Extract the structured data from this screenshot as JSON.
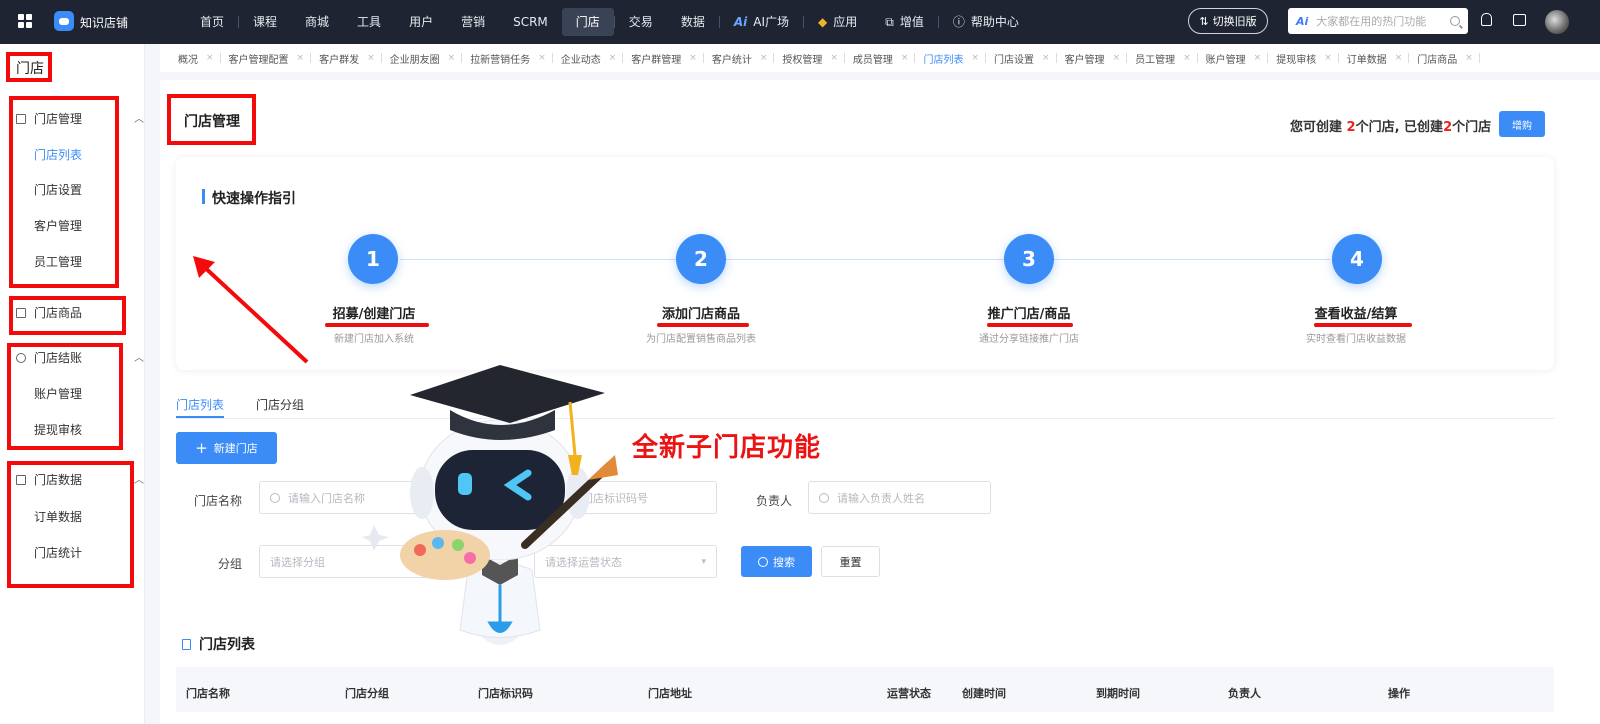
{
  "topbar": {
    "brand": "知识店铺",
    "nav": [
      "首页",
      "课程",
      "商城",
      "工具",
      "用户",
      "营销",
      "SCRM",
      "门店",
      "交易",
      "数据",
      "AI广场",
      "应用",
      "增值",
      "帮助中心"
    ],
    "nav_ai_prefix": "Ai",
    "switch_label": "切换旧版",
    "search_ai_badge": "Ai",
    "search_placeholder": "大家都在用的热门功能"
  },
  "sidebar": {
    "title": "门店",
    "groups": [
      {
        "label": "门店管理",
        "icon": "building-icon",
        "items": [
          "门店列表",
          "门店设置",
          "客户管理",
          "员工管理"
        ]
      },
      {
        "label": "门店商品",
        "icon": "goods-icon",
        "items": []
      },
      {
        "label": "门店结账",
        "icon": "database-icon",
        "items": [
          "账户管理",
          "提现审核"
        ]
      },
      {
        "label": "门店数据",
        "icon": "chart-icon",
        "items": [
          "订单数据",
          "门店统计"
        ]
      }
    ]
  },
  "tabs": [
    "概况",
    "客户管理配置",
    "客户群发",
    "企业朋友圈",
    "拉新营销任务",
    "企业动态",
    "客户群管理",
    "客户统计",
    "授权管理",
    "成员管理",
    "门店列表",
    "门店设置",
    "客户管理",
    "员工管理",
    "账户管理",
    "提现审核",
    "订单数据",
    "门店商品"
  ],
  "page": {
    "title": "门店管理",
    "quota_prefix": "您可创建",
    "quota_total": "2",
    "quota_mid": "个门店, 已创建",
    "quota_used": "2",
    "quota_suffix": "个门店",
    "buy_label": "增购"
  },
  "guide": {
    "title": "快速操作指引",
    "steps": [
      {
        "num": "1",
        "title": "招募/创建门店",
        "desc": "新建门店加入系统"
      },
      {
        "num": "2",
        "title": "添加门店商品",
        "desc": "为门店配置销售商品列表"
      },
      {
        "num": "3",
        "title": "推广门店/商品",
        "desc": "通过分享链接推广门店"
      },
      {
        "num": "4",
        "title": "查看收益/结算",
        "desc": "实时查看门店收益数据"
      }
    ]
  },
  "list_tabs": [
    "门店列表",
    "门店分组"
  ],
  "new_store_label": "新建门店",
  "filters": {
    "name_label": "门店名称",
    "name_placeholder": "请输入门店名称",
    "code_placeholder": "请输入门店标识码号",
    "owner_label": "负责人",
    "owner_placeholder": "请输入负责人姓名",
    "group_label": "分组",
    "group_placeholder": "请选择分组",
    "status_placeholder": "请选择运营状态",
    "search_label": "搜索",
    "reset_label": "重置"
  },
  "list": {
    "title": "门店列表",
    "columns": [
      "门店名称",
      "门店分组",
      "门店标识码",
      "门店地址",
      "运营状态",
      "创建时间",
      "到期时间",
      "负责人",
      "操作"
    ]
  },
  "promo": "全新子门店功能",
  "colors": {
    "accent": "#3b8cf7",
    "highlight_red": "#f40a0a",
    "topbar": "#1e2431"
  }
}
